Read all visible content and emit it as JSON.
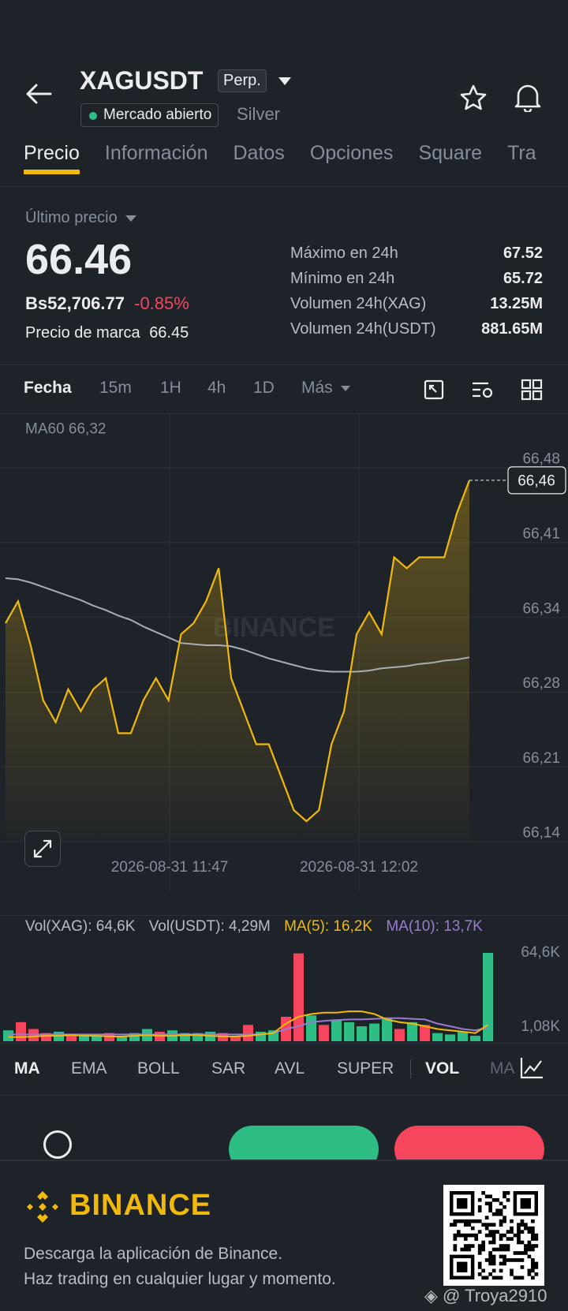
{
  "header": {
    "symbol": "XAGUSDT",
    "contract_type": "Perp.",
    "market_status": "Mercado abierto",
    "asset_name": "Silver",
    "icons": [
      "back-arrow-icon",
      "chevron-down-icon",
      "star-icon",
      "bell-icon"
    ]
  },
  "tabs": [
    "Precio",
    "Información",
    "Datos",
    "Opciones",
    "Square",
    "Tra"
  ],
  "price": {
    "label": "Último precio",
    "last": "66.46",
    "local_value": "Bs52,706.77",
    "change": "-0.85%",
    "mark_label": "Precio de marca",
    "mark_value": "66.45"
  },
  "stats": [
    {
      "label": "Máximo en 24h",
      "value": "67.52"
    },
    {
      "label": "Mínimo en 24h",
      "value": "65.72"
    },
    {
      "label": "Volumen 24h(XAG)",
      "value": "13.25M"
    },
    {
      "label": "Volumen 24h(USDT)",
      "value": "881.65M"
    }
  ],
  "timeframes": {
    "date_label": "Fecha",
    "items": [
      "15m",
      "1H",
      "4h",
      "1D"
    ],
    "more": "Más"
  },
  "colors": {
    "accent": "#f0b90b",
    "up": "#2ebd85",
    "down": "#f6465d",
    "ma_line": "#a9adb3",
    "ma10": "#9a7bd0"
  },
  "chart_data": {
    "type": "line",
    "ma_label": "MA60 66,32",
    "current_price_tag": "66,46",
    "y_ticks": [
      "66,48",
      "66,41",
      "66,34",
      "66,28",
      "66,21",
      "66,14"
    ],
    "x_ticks": [
      "2026-08-31 11:47",
      "2026-08-31 12:02"
    ],
    "ylim": [
      66.14,
      66.48
    ],
    "series": [
      {
        "values": [
          66.33,
          66.35,
          66.31,
          66.26,
          66.24,
          66.27,
          66.25,
          66.27,
          66.28,
          66.23,
          66.23,
          66.26,
          66.28,
          66.26,
          66.32,
          66.33,
          66.35,
          66.38,
          66.28,
          66.25,
          66.22,
          66.22,
          66.19,
          66.16,
          66.15,
          66.16,
          66.22,
          66.25,
          66.32,
          66.34,
          66.32,
          66.39,
          66.38,
          66.39,
          66.39,
          66.39,
          66.43,
          66.46
        ]
      },
      {
        "values": [
          66.371,
          66.37,
          66.367,
          66.363,
          66.359,
          66.355,
          66.351,
          66.346,
          66.342,
          66.337,
          66.333,
          66.327,
          66.322,
          66.317,
          66.312,
          66.311,
          66.31,
          66.31,
          66.309,
          66.306,
          66.302,
          66.298,
          66.295,
          66.292,
          66.289,
          66.287,
          66.286,
          66.286,
          66.286,
          66.287,
          66.289,
          66.29,
          66.291,
          66.293,
          66.294,
          66.296,
          66.297,
          66.299
        ]
      }
    ]
  },
  "volume_panel": {
    "vol_xag": "Vol(XAG): 64,6K",
    "vol_usdt": "Vol(USDT): 4,29M",
    "ma5": "MA(5): 16,2K",
    "ma10": "MA(10): 13,7K",
    "y_ticks": [
      "64,6K",
      "1,08K"
    ],
    "bars": [
      {
        "v": 8,
        "up": true
      },
      {
        "v": 14,
        "up": false
      },
      {
        "v": 9,
        "up": false
      },
      {
        "v": 6,
        "up": false
      },
      {
        "v": 7,
        "up": true
      },
      {
        "v": 4,
        "up": false
      },
      {
        "v": 5,
        "up": true
      },
      {
        "v": 4,
        "up": true
      },
      {
        "v": 6,
        "up": false
      },
      {
        "v": 4,
        "up": true
      },
      {
        "v": 6,
        "up": true
      },
      {
        "v": 9,
        "up": true
      },
      {
        "v": 7,
        "up": false
      },
      {
        "v": 8,
        "up": true
      },
      {
        "v": 6,
        "up": true
      },
      {
        "v": 6,
        "up": true
      },
      {
        "v": 7,
        "up": true
      },
      {
        "v": 6,
        "up": false
      },
      {
        "v": 4,
        "up": false
      },
      {
        "v": 12,
        "up": false
      },
      {
        "v": 7,
        "up": true
      },
      {
        "v": 8,
        "up": true
      },
      {
        "v": 18,
        "up": false
      },
      {
        "v": 64.6,
        "up": false
      },
      {
        "v": 19,
        "up": true
      },
      {
        "v": 12,
        "up": false
      },
      {
        "v": 16,
        "up": true
      },
      {
        "v": 14,
        "up": true
      },
      {
        "v": 11,
        "up": true
      },
      {
        "v": 13,
        "up": true
      },
      {
        "v": 17,
        "up": true
      },
      {
        "v": 9,
        "up": false
      },
      {
        "v": 14,
        "up": true
      },
      {
        "v": 12,
        "up": false
      },
      {
        "v": 6,
        "up": true
      },
      {
        "v": 5,
        "up": true
      },
      {
        "v": 7,
        "up": true
      },
      {
        "v": 4,
        "up": true
      },
      {
        "v": 65,
        "up": true
      }
    ],
    "ma5_values": [
      3,
      3,
      3.5,
      4,
      4,
      4.5,
      4,
      4,
      3.5,
      3.5,
      4,
      4.5,
      4,
      4,
      4.5,
      4.5,
      4,
      3.5,
      3.5,
      4,
      5,
      6,
      13,
      18,
      20,
      21,
      21,
      22,
      22,
      20,
      16,
      14,
      13,
      11,
      9,
      8,
      7,
      6,
      12
    ],
    "ma10_values": [
      5,
      5,
      5,
      5,
      5,
      5,
      5,
      5,
      5,
      5,
      5,
      5,
      5,
      5,
      5,
      5,
      5,
      5,
      5,
      5,
      5,
      6,
      9,
      11,
      14,
      15,
      15.5,
      16,
      16,
      16.5,
      17,
      17,
      16.5,
      16,
      13,
      11,
      9,
      8,
      10
    ]
  },
  "indicator_tabs": [
    "MA",
    "EMA",
    "BOLL",
    "SAR",
    "AVL",
    "SUPER",
    "VOL",
    "MA"
  ],
  "footer": {
    "brand": "BINANCE",
    "line1": "Descarga la aplicación de Binance.",
    "line2": "Haz trading en cualquier lugar y momento.",
    "watermark": "@ Troya2910"
  }
}
